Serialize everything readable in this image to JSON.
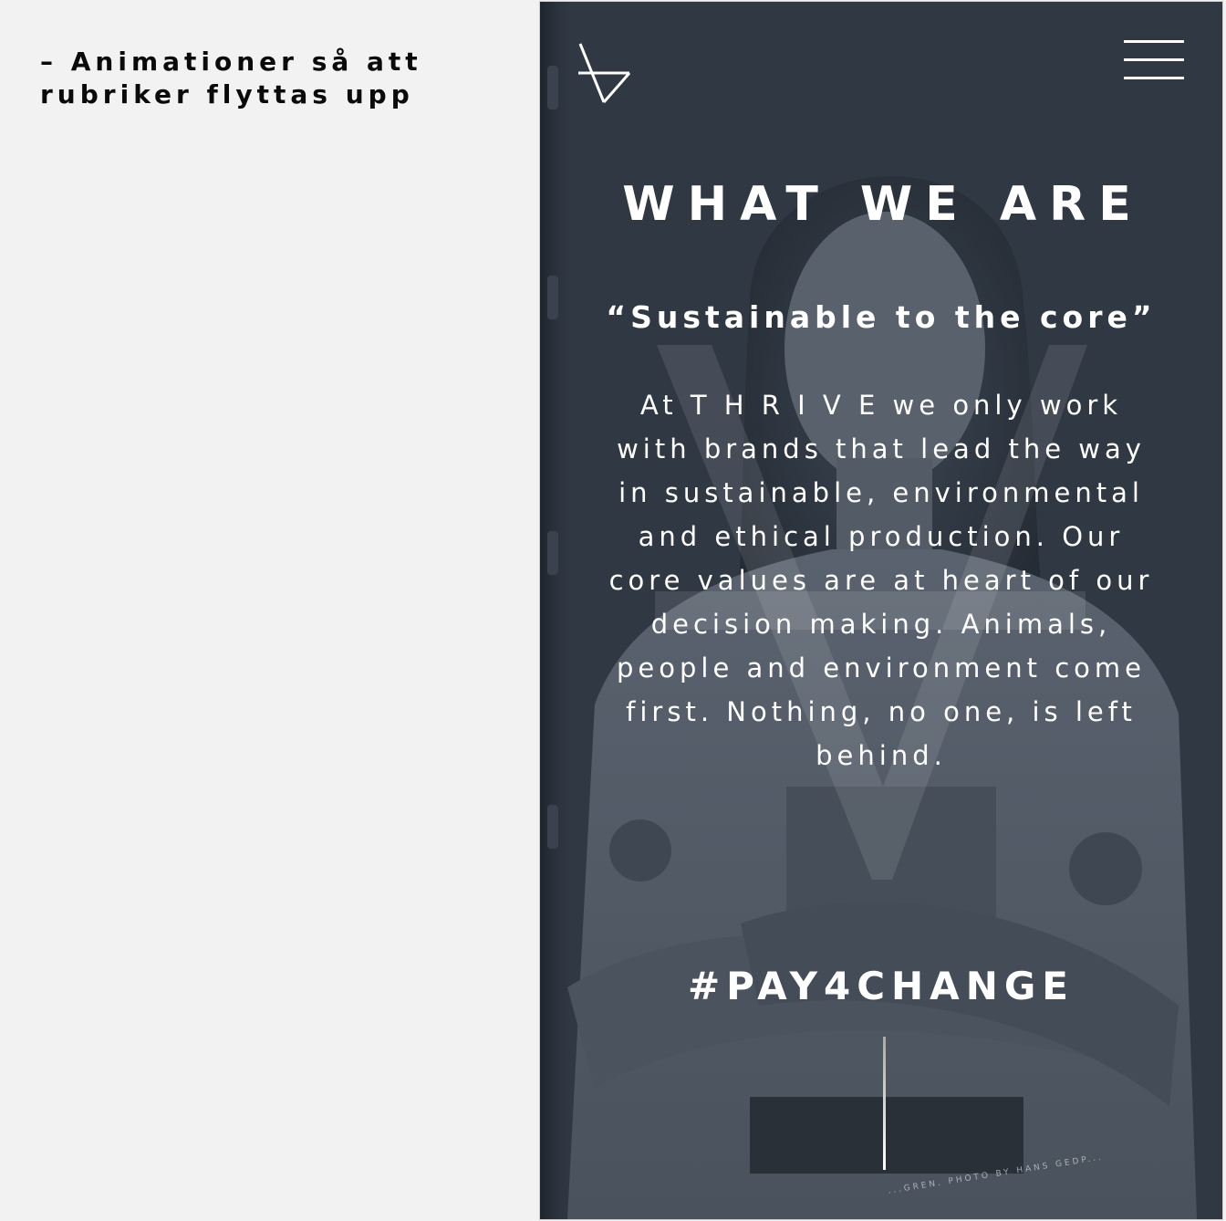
{
  "annotation": {
    "text": "– Animationer så att rubriker flyttas upp"
  },
  "mobile": {
    "logo_icon": "thrive-logo-icon",
    "menu_icon": "hamburger-menu-icon",
    "title": "WHAT WE ARE",
    "subtitle": "“Sustainable to the core”",
    "body": "At T H R I V E we only work with brands that lead the way in sustainable, environmental and ethical production. Our core values are at heart of our decision making. Animals, people and environment come first. Nothing, no one, is left behind.",
    "hashtag": "#PAY4CHANGE",
    "photo_credit": "...GREN. PHOTO BY HANS GEDP...",
    "colors": {
      "overlay": "#313945",
      "text": "#ffffff",
      "annotation_text": "#0a0a0a",
      "page_background": "#f2f2f2"
    }
  }
}
